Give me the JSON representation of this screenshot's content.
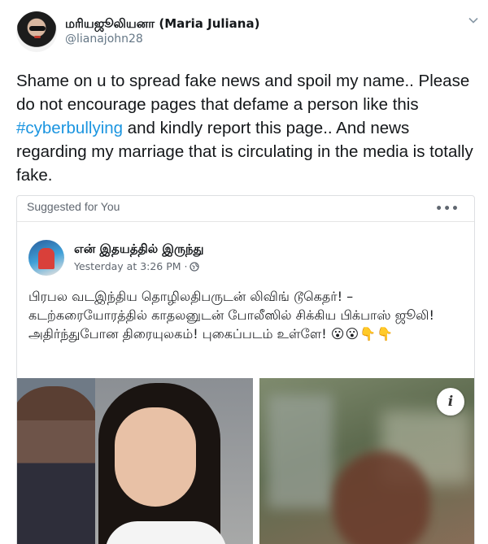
{
  "tweet": {
    "display_name": "மரியஜூலியனா (Maria Juliana)",
    "handle": "@lianajohn28",
    "text_before": "Shame on u to spread fake news and spoil my name.. Please do not encourage pages that defame a person like this ",
    "hashtag": "#cyberbullying",
    "text_after": " and kindly report this page.. And news regarding my marriage that is circulating in the media is totally fake.",
    "caret_icon": "chevron-down-icon"
  },
  "facebook_card": {
    "suggested_label": "Suggested for You",
    "more_label": "•••",
    "page_name": "என் இதயத்தில் இருந்து",
    "timestamp": "Yesterday at 3:26 PM ·",
    "post_text": "பிரபல வடஇந்திய தொழிலதிபருடன் லிவிங் டூகெதர்! – கடற்கரையோரத்தில் காதலனுடன் போலீஸில் சிக்கிய பிக்பாஸ் ஜூலி! அதிர்ந்துபோன திரையுலகம்! புகைப்படம் உள்ளே!",
    "post_emoji": "😮😮👇👇",
    "info_label": "i"
  }
}
